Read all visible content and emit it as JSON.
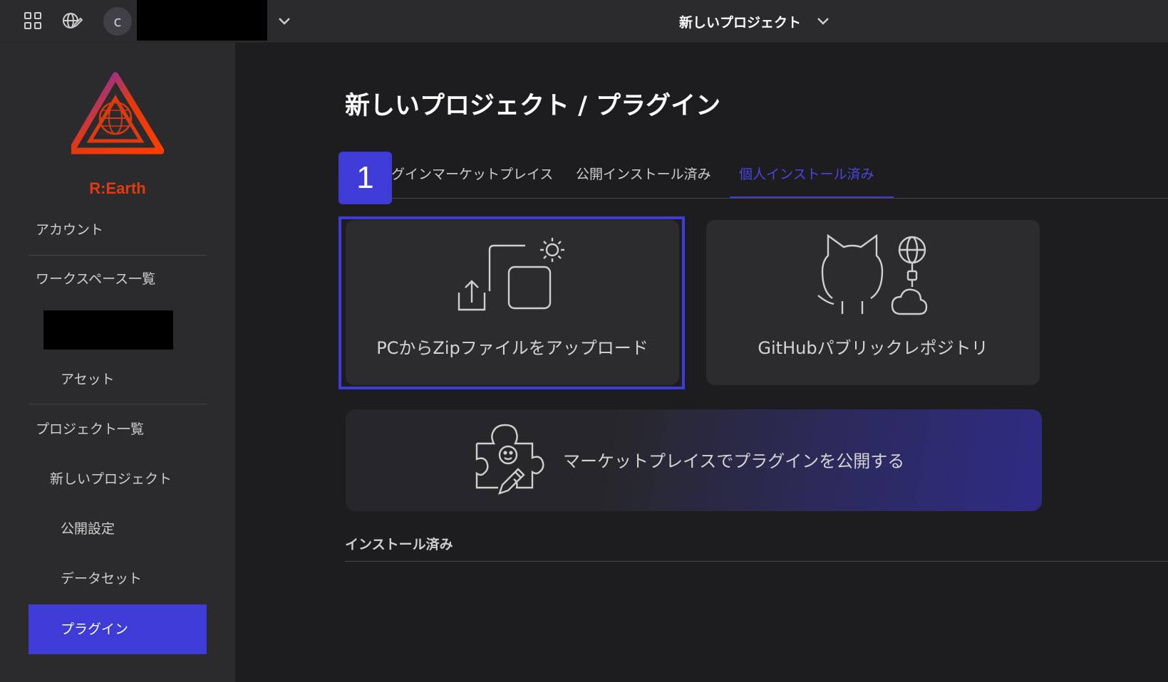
{
  "topbar": {
    "avatar_initial": "c",
    "project_name": "新しいプロジェクト"
  },
  "sidebar": {
    "logo_text": "R:Earth",
    "items": [
      {
        "label": "アカウント"
      },
      {
        "label": "ワークスペース一覧"
      },
      {
        "label": "アセット"
      },
      {
        "label": "プロジェクト一覧"
      },
      {
        "label": "新しいプロジェクト"
      },
      {
        "label": "公開設定"
      },
      {
        "label": "データセット"
      },
      {
        "label": "プラグイン"
      }
    ],
    "active_index": 7
  },
  "main": {
    "title": "新しいプロジェクト / プラグイン",
    "step_badge": "1",
    "tabs": [
      {
        "label": "ラグインマーケットプレイス",
        "active": false
      },
      {
        "label": "公開インストール済み",
        "active": false
      },
      {
        "label": "個人インストール済み",
        "active": true
      }
    ],
    "cards": {
      "upload_label": "PCからZipファイルをアップロード",
      "github_label": "GitHubパブリックレポジトリ"
    },
    "publish_label": "マーケットプレイスでプラグインを公開する",
    "installed_heading": "インストール済み"
  },
  "colors": {
    "accent": "#3f3bd6",
    "background": "#1d1d20",
    "panel": "#2b2b2e",
    "logo_red": "#e23a10"
  }
}
